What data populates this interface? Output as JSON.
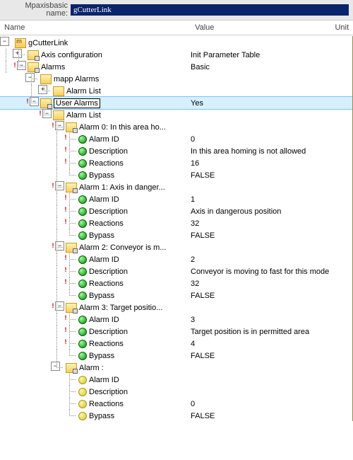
{
  "top": {
    "label": "Mpaxisbasic name:",
    "value": "gCutterLink"
  },
  "cols": {
    "name": "Name",
    "value": "Value",
    "unit": "Unit"
  },
  "root": {
    "label": "gCutterLink"
  },
  "axis": {
    "label": "Axis configuration",
    "value": "Init Parameter Table"
  },
  "alarms": {
    "label": "Alarms",
    "value": "Basic"
  },
  "mapp": {
    "label": "mapp Alarms",
    "list": "Alarm List"
  },
  "user": {
    "label": "User Alarms",
    "value": "Yes",
    "list": "Alarm List"
  },
  "a0": {
    "title": "Alarm 0: In this area ho...",
    "id": {
      "k": "Alarm ID",
      "v": "0"
    },
    "desc": {
      "k": "Description",
      "v": "In this area homing is not allowed"
    },
    "react": {
      "k": "Reactions",
      "v": "16"
    },
    "byp": {
      "k": "Bypass",
      "v": "FALSE"
    }
  },
  "a1": {
    "title": "Alarm 1: Axis in danger...",
    "id": {
      "k": "Alarm ID",
      "v": "1"
    },
    "desc": {
      "k": "Description",
      "v": "Axis in dangerous position"
    },
    "react": {
      "k": "Reactions",
      "v": "32"
    },
    "byp": {
      "k": "Bypass",
      "v": "FALSE"
    }
  },
  "a2": {
    "title": "Alarm 2: Conveyor is m...",
    "id": {
      "k": "Alarm ID",
      "v": "2"
    },
    "desc": {
      "k": "Description",
      "v": "Conveyor is moving to fast for this mode"
    },
    "react": {
      "k": "Reactions",
      "v": "32"
    },
    "byp": {
      "k": "Bypass",
      "v": "FALSE"
    }
  },
  "a3": {
    "title": "Alarm 3: Target positio...",
    "id": {
      "k": "Alarm ID",
      "v": "3"
    },
    "desc": {
      "k": "Description",
      "v": "Target position is in permitted area"
    },
    "react": {
      "k": "Reactions",
      "v": "4"
    },
    "byp": {
      "k": "Bypass",
      "v": "FALSE"
    }
  },
  "a4": {
    "title": "Alarm :",
    "id": {
      "k": "Alarm ID",
      "v": ""
    },
    "desc": {
      "k": "Description",
      "v": ""
    },
    "react": {
      "k": "Reactions",
      "v": "0"
    },
    "byp": {
      "k": "Bypass",
      "v": "FALSE"
    }
  }
}
